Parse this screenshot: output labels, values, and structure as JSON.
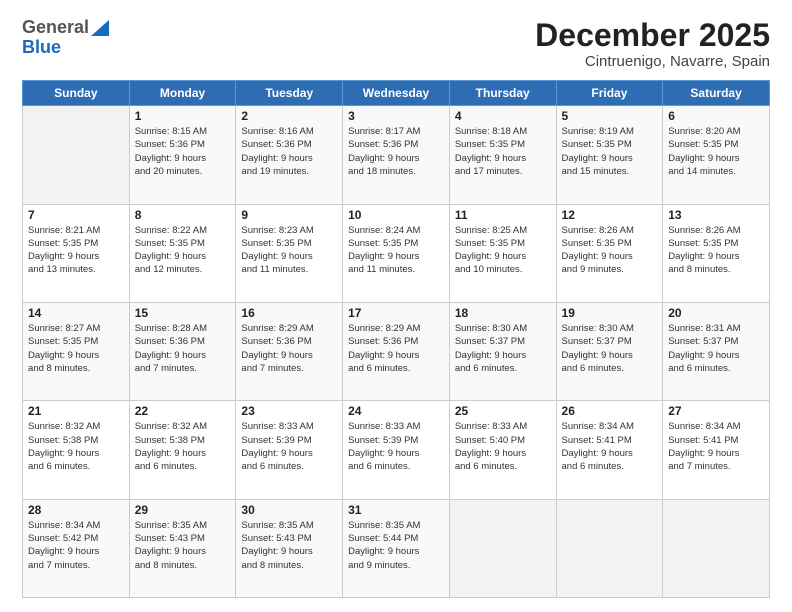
{
  "logo": {
    "line1": "General",
    "line2": "Blue"
  },
  "title": "December 2025",
  "subtitle": "Cintruenigo, Navarre, Spain",
  "days_of_week": [
    "Sunday",
    "Monday",
    "Tuesday",
    "Wednesday",
    "Thursday",
    "Friday",
    "Saturday"
  ],
  "weeks": [
    [
      {
        "num": "",
        "info": ""
      },
      {
        "num": "1",
        "info": "Sunrise: 8:15 AM\nSunset: 5:36 PM\nDaylight: 9 hours\nand 20 minutes."
      },
      {
        "num": "2",
        "info": "Sunrise: 8:16 AM\nSunset: 5:36 PM\nDaylight: 9 hours\nand 19 minutes."
      },
      {
        "num": "3",
        "info": "Sunrise: 8:17 AM\nSunset: 5:36 PM\nDaylight: 9 hours\nand 18 minutes."
      },
      {
        "num": "4",
        "info": "Sunrise: 8:18 AM\nSunset: 5:35 PM\nDaylight: 9 hours\nand 17 minutes."
      },
      {
        "num": "5",
        "info": "Sunrise: 8:19 AM\nSunset: 5:35 PM\nDaylight: 9 hours\nand 15 minutes."
      },
      {
        "num": "6",
        "info": "Sunrise: 8:20 AM\nSunset: 5:35 PM\nDaylight: 9 hours\nand 14 minutes."
      }
    ],
    [
      {
        "num": "7",
        "info": "Sunrise: 8:21 AM\nSunset: 5:35 PM\nDaylight: 9 hours\nand 13 minutes."
      },
      {
        "num": "8",
        "info": "Sunrise: 8:22 AM\nSunset: 5:35 PM\nDaylight: 9 hours\nand 12 minutes."
      },
      {
        "num": "9",
        "info": "Sunrise: 8:23 AM\nSunset: 5:35 PM\nDaylight: 9 hours\nand 11 minutes."
      },
      {
        "num": "10",
        "info": "Sunrise: 8:24 AM\nSunset: 5:35 PM\nDaylight: 9 hours\nand 11 minutes."
      },
      {
        "num": "11",
        "info": "Sunrise: 8:25 AM\nSunset: 5:35 PM\nDaylight: 9 hours\nand 10 minutes."
      },
      {
        "num": "12",
        "info": "Sunrise: 8:26 AM\nSunset: 5:35 PM\nDaylight: 9 hours\nand 9 minutes."
      },
      {
        "num": "13",
        "info": "Sunrise: 8:26 AM\nSunset: 5:35 PM\nDaylight: 9 hours\nand 8 minutes."
      }
    ],
    [
      {
        "num": "14",
        "info": "Sunrise: 8:27 AM\nSunset: 5:35 PM\nDaylight: 9 hours\nand 8 minutes."
      },
      {
        "num": "15",
        "info": "Sunrise: 8:28 AM\nSunset: 5:36 PM\nDaylight: 9 hours\nand 7 minutes."
      },
      {
        "num": "16",
        "info": "Sunrise: 8:29 AM\nSunset: 5:36 PM\nDaylight: 9 hours\nand 7 minutes."
      },
      {
        "num": "17",
        "info": "Sunrise: 8:29 AM\nSunset: 5:36 PM\nDaylight: 9 hours\nand 6 minutes."
      },
      {
        "num": "18",
        "info": "Sunrise: 8:30 AM\nSunset: 5:37 PM\nDaylight: 9 hours\nand 6 minutes."
      },
      {
        "num": "19",
        "info": "Sunrise: 8:30 AM\nSunset: 5:37 PM\nDaylight: 9 hours\nand 6 minutes."
      },
      {
        "num": "20",
        "info": "Sunrise: 8:31 AM\nSunset: 5:37 PM\nDaylight: 9 hours\nand 6 minutes."
      }
    ],
    [
      {
        "num": "21",
        "info": "Sunrise: 8:32 AM\nSunset: 5:38 PM\nDaylight: 9 hours\nand 6 minutes."
      },
      {
        "num": "22",
        "info": "Sunrise: 8:32 AM\nSunset: 5:38 PM\nDaylight: 9 hours\nand 6 minutes."
      },
      {
        "num": "23",
        "info": "Sunrise: 8:33 AM\nSunset: 5:39 PM\nDaylight: 9 hours\nand 6 minutes."
      },
      {
        "num": "24",
        "info": "Sunrise: 8:33 AM\nSunset: 5:39 PM\nDaylight: 9 hours\nand 6 minutes."
      },
      {
        "num": "25",
        "info": "Sunrise: 8:33 AM\nSunset: 5:40 PM\nDaylight: 9 hours\nand 6 minutes."
      },
      {
        "num": "26",
        "info": "Sunrise: 8:34 AM\nSunset: 5:41 PM\nDaylight: 9 hours\nand 6 minutes."
      },
      {
        "num": "27",
        "info": "Sunrise: 8:34 AM\nSunset: 5:41 PM\nDaylight: 9 hours\nand 7 minutes."
      }
    ],
    [
      {
        "num": "28",
        "info": "Sunrise: 8:34 AM\nSunset: 5:42 PM\nDaylight: 9 hours\nand 7 minutes."
      },
      {
        "num": "29",
        "info": "Sunrise: 8:35 AM\nSunset: 5:43 PM\nDaylight: 9 hours\nand 8 minutes."
      },
      {
        "num": "30",
        "info": "Sunrise: 8:35 AM\nSunset: 5:43 PM\nDaylight: 9 hours\nand 8 minutes."
      },
      {
        "num": "31",
        "info": "Sunrise: 8:35 AM\nSunset: 5:44 PM\nDaylight: 9 hours\nand 9 minutes."
      },
      {
        "num": "",
        "info": ""
      },
      {
        "num": "",
        "info": ""
      },
      {
        "num": "",
        "info": ""
      }
    ]
  ]
}
